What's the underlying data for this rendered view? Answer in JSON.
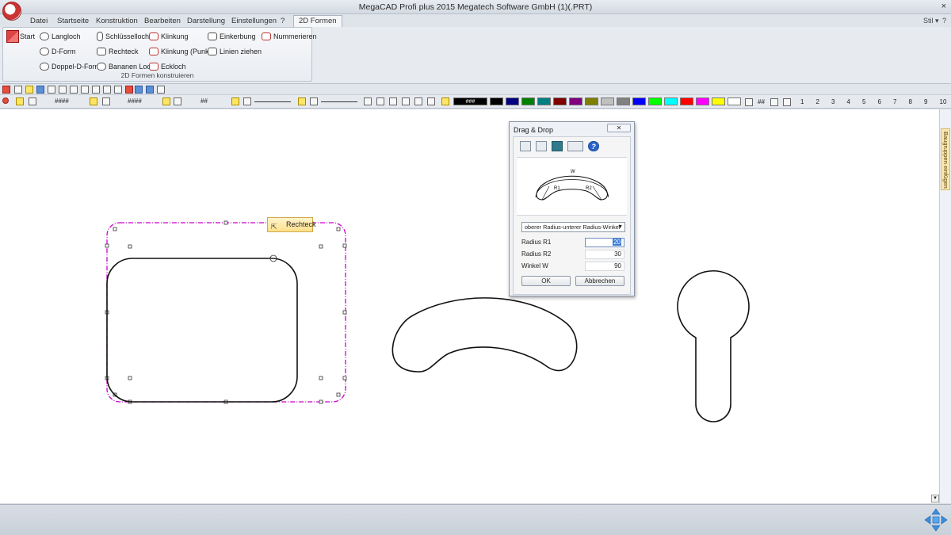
{
  "window": {
    "title": "MegaCAD Profi plus 2015 Megatech Software GmbH (1)(.PRT)",
    "close_glyph": "×",
    "help_glyph": "?"
  },
  "menu": {
    "tabs": [
      "Datei",
      "Startseite",
      "Konstruktion",
      "Bearbeiten",
      "Darstellung",
      "Einstellungen",
      "?",
      "2D Formen"
    ],
    "style_label": "Stil",
    "style_chevron": "▾",
    "help_glyph": "?"
  },
  "ribbon": {
    "start_label": "Start",
    "items": [
      "Langloch",
      "D-Form",
      "Doppel-D-Form",
      "Schlüsselloch",
      "Rechteck",
      "Bananen Loch",
      "Klinkung",
      "Klinkung (Punkt)",
      "Eckloch",
      "Einkerbung",
      "Linien ziehen",
      "Nummerieren"
    ],
    "group_caption": "2D Formen konstruieren"
  },
  "toolbar": {
    "field_hash": "####",
    "field_hash2": "####",
    "field_small": "##",
    "color_first_label": "###",
    "hash_end": "##",
    "level_numbers": [
      "1",
      "2",
      "3",
      "4",
      "5",
      "6",
      "7",
      "8",
      "9",
      "10"
    ],
    "colors": [
      "#000000",
      "#000080",
      "#008000",
      "#008080",
      "#800000",
      "#800080",
      "#808000",
      "#c0c0c0",
      "#808080",
      "#0000ff",
      "#00ff00",
      "#00ffff",
      "#ff0000",
      "#ff00ff",
      "#ffff00",
      "#ffffff"
    ]
  },
  "canvas": {
    "tooltip_label": "Rechteck",
    "side_panel_label": "Baugruppen einfügen",
    "selection_color": "#cc00cc"
  },
  "dialog": {
    "title": "Drag & Drop",
    "close_glyph": "✕",
    "preview_labels": {
      "w": "W",
      "r1": "R1",
      "r2": "R2"
    },
    "mode_select": "oberer Radius-unterer Radius-Winkel",
    "fields": [
      {
        "label": "Radius R1",
        "value": "20"
      },
      {
        "label": "Radius R2",
        "value": "30"
      },
      {
        "label": "Winkel W",
        "value": "90"
      }
    ],
    "ok_label": "OK",
    "cancel_label": "Abbrechen"
  }
}
